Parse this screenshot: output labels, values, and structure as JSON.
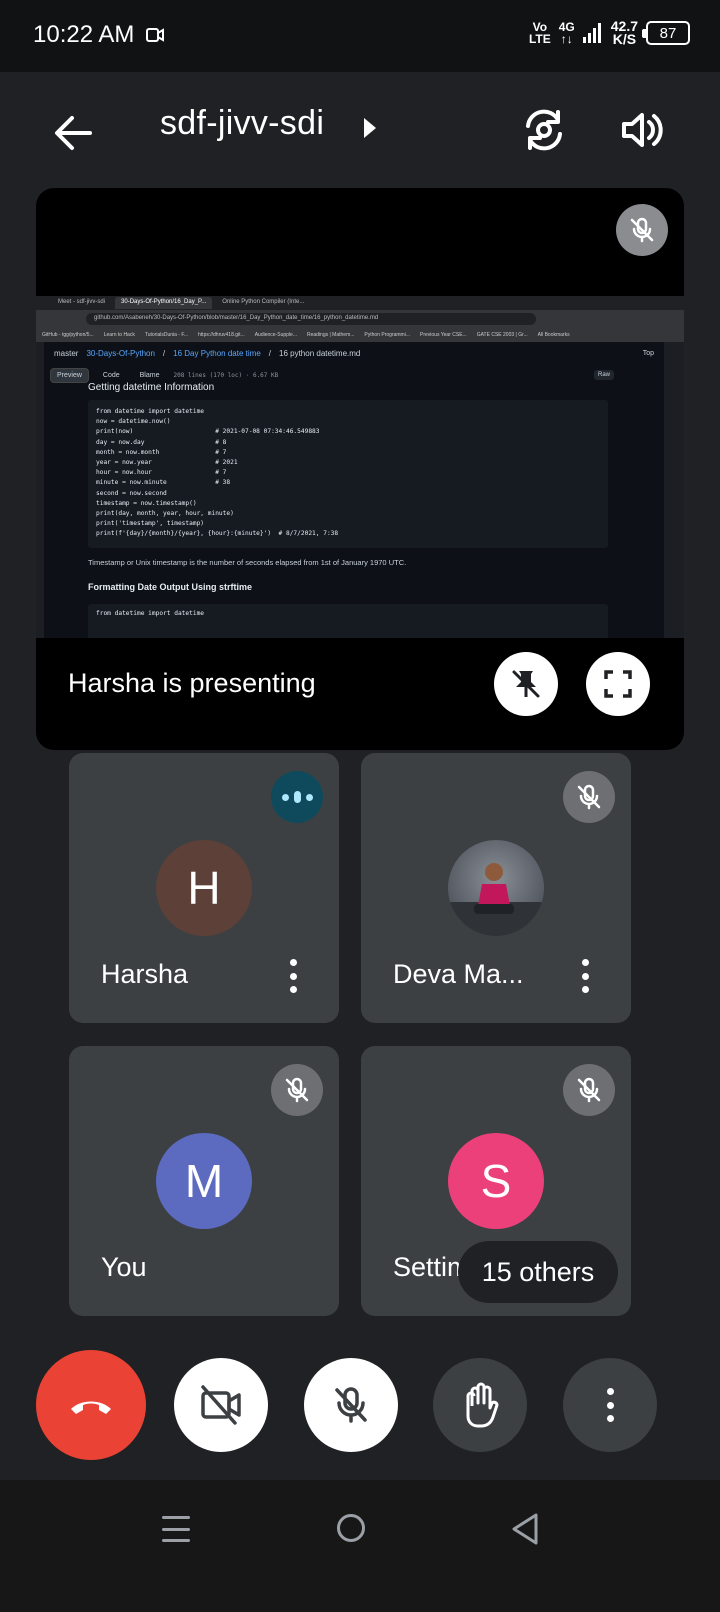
{
  "status_bar": {
    "time": "10:22 AM",
    "network_labels": [
      "Vo",
      "LTE",
      "4G"
    ],
    "speed_value": "42.7",
    "speed_unit": "K/S",
    "battery": "87"
  },
  "header": {
    "meeting_code": "sdf-jivv-sdi"
  },
  "presentation": {
    "label": "Harsha is presenting",
    "shared_screen": {
      "tabs": [
        "Meet - sdf-jivv-sdi",
        "30-Days-Of-Python/16_Day_P...",
        "Online Python Compiler (Inte..."
      ],
      "url": "github.com/Asabeneh/30-Days-Of-Python/blob/master/16_Day_Python_date_time/16_python_datetime.md",
      "bookmarks": [
        "GitHub - tgg/python/5...",
        "Learn to Hack",
        "TutorialsDunia - F...",
        "https://dhruv418.git...",
        "Audience-Supple...",
        "Readings | Mathem...",
        "Python Programmi...",
        "Previous Year CSE...",
        "GATE CSE 2003 | Gr...",
        "All Bookmarks"
      ],
      "branch": "master",
      "path_repo": "30-Days-Of-Python",
      "path_dir": "16 Day Python date time",
      "path_file": "16 python datetime.md",
      "top_link": "Top",
      "tabs_gh": [
        "Preview",
        "Code",
        "Blame"
      ],
      "file_meta": "208 lines (170 loc) · 6.67 KB",
      "raw_label": "Raw",
      "heading": "Getting datetime Information",
      "code_lines": [
        "from datetime import datetime",
        "now = datetime.now()",
        "print(now)                      # 2021-07-08 07:34:46.549883",
        "day = now.day                   # 8",
        "month = now.month               # 7",
        "year = now.year                 # 2021",
        "hour = now.hour                 # 7",
        "minute = now.minute             # 38",
        "second = now.second",
        "timestamp = now.timestamp()",
        "print(day, month, year, hour, minute)",
        "print('timestamp', timestamp)",
        "print(f'{day}/{month}/{year}, {hour}:{minute}')  # 8/7/2021, 7:38"
      ],
      "paragraph": "Timestamp or Unix timestamp is the number of seconds elapsed from 1st of January 1970 UTC.",
      "heading2": "Formatting Date Output Using strftime",
      "code2_line": "from datetime import datetime"
    }
  },
  "participants": [
    {
      "name": "Harsha",
      "initial": "H",
      "color": "#5d4037",
      "state": "speaking"
    },
    {
      "name": "Deva Ma...",
      "initial": "",
      "color": "",
      "state": "muted"
    },
    {
      "name": "You",
      "initial": "M",
      "color": "#5c6bc0",
      "state": "muted"
    },
    {
      "name": "Settim",
      "initial": "S",
      "color": "#ec407a",
      "state": "muted"
    }
  ],
  "others_chip": "15 others",
  "controls": {
    "end_call_color": "#ea4335"
  }
}
